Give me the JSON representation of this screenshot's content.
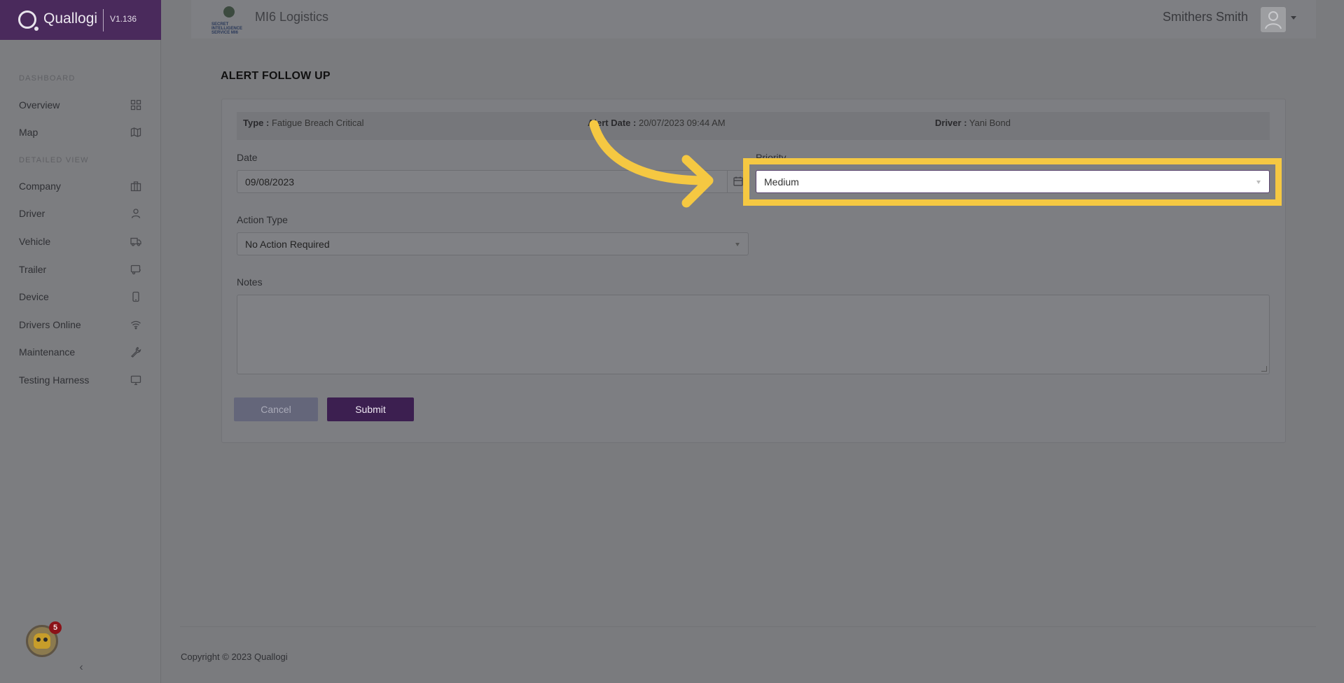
{
  "app": {
    "name": "Quallogi",
    "version": "V1.136"
  },
  "sidebar": {
    "sections": [
      {
        "label": "DASHBOARD"
      },
      {
        "label": "DETAILED VIEW"
      }
    ],
    "items": [
      {
        "label": "Overview",
        "icon": "grid-icon"
      },
      {
        "label": "Map",
        "icon": "map-icon"
      },
      {
        "label": "Company",
        "icon": "briefcase-icon"
      },
      {
        "label": "Driver",
        "icon": "person-icon"
      },
      {
        "label": "Vehicle",
        "icon": "truck-icon"
      },
      {
        "label": "Trailer",
        "icon": "trailer-icon"
      },
      {
        "label": "Device",
        "icon": "phone-icon"
      },
      {
        "label": "Drivers Online",
        "icon": "wifi-icon"
      },
      {
        "label": "Maintenance",
        "icon": "wrench-icon"
      },
      {
        "label": "Testing Harness",
        "icon": "monitor-icon"
      }
    ],
    "notifications_badge": "5"
  },
  "header": {
    "org_logo_text": "SECRET INTELLIGENCE SERVICE MI6",
    "org_name": "MI6 Logistics",
    "user_name": "Smithers Smith"
  },
  "main": {
    "title": "ALERT FOLLOW UP",
    "info": {
      "type_label": "Type :",
      "type_value": "Fatigue Breach Critical",
      "alert_date_label": "Alert Date :",
      "alert_date_value": "20/07/2023 09:44 AM",
      "driver_label": "Driver :",
      "driver_value": "Yani Bond"
    },
    "form": {
      "date_label": "Date",
      "date_value": "09/08/2023",
      "priority_label": "Priority",
      "priority_value": "Medium",
      "action_type_label": "Action Type",
      "action_type_value": "No Action Required",
      "notes_label": "Notes",
      "notes_value": ""
    },
    "buttons": {
      "cancel": "Cancel",
      "submit": "Submit"
    }
  },
  "footer": {
    "copyright": "Copyright © 2023 Quallogi"
  },
  "colors": {
    "brand": "#4a2a5c",
    "submit": "#3c1f50",
    "highlight": "#f5c842"
  }
}
